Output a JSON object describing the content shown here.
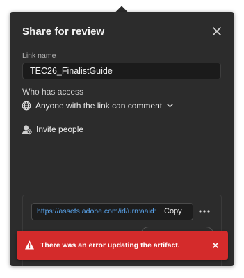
{
  "dialog": {
    "title": "Share for review",
    "close_icon": "close-icon"
  },
  "link_name": {
    "label": "Link name",
    "value": "TEC26_FinalistGuide"
  },
  "access": {
    "label": "Who has access",
    "selected": "Anyone with the link can comment",
    "icon": "globe-icon",
    "dropdown_icon": "chevron-down-icon"
  },
  "invite": {
    "label": "Invite people",
    "icon": "person-add-icon"
  },
  "share_link": {
    "url": "https://assets.adobe.com/id/urn:aaid:s...",
    "copy_label": "Copy",
    "more_icon": "more-icon"
  },
  "toast": {
    "message": "There was an error updating the artifact.",
    "icon": "alert-icon",
    "close_icon": "close-icon",
    "color": "#d42b2b"
  },
  "colors": {
    "dialog_bg": "#2c2c2c",
    "link": "#5aa6f0"
  }
}
